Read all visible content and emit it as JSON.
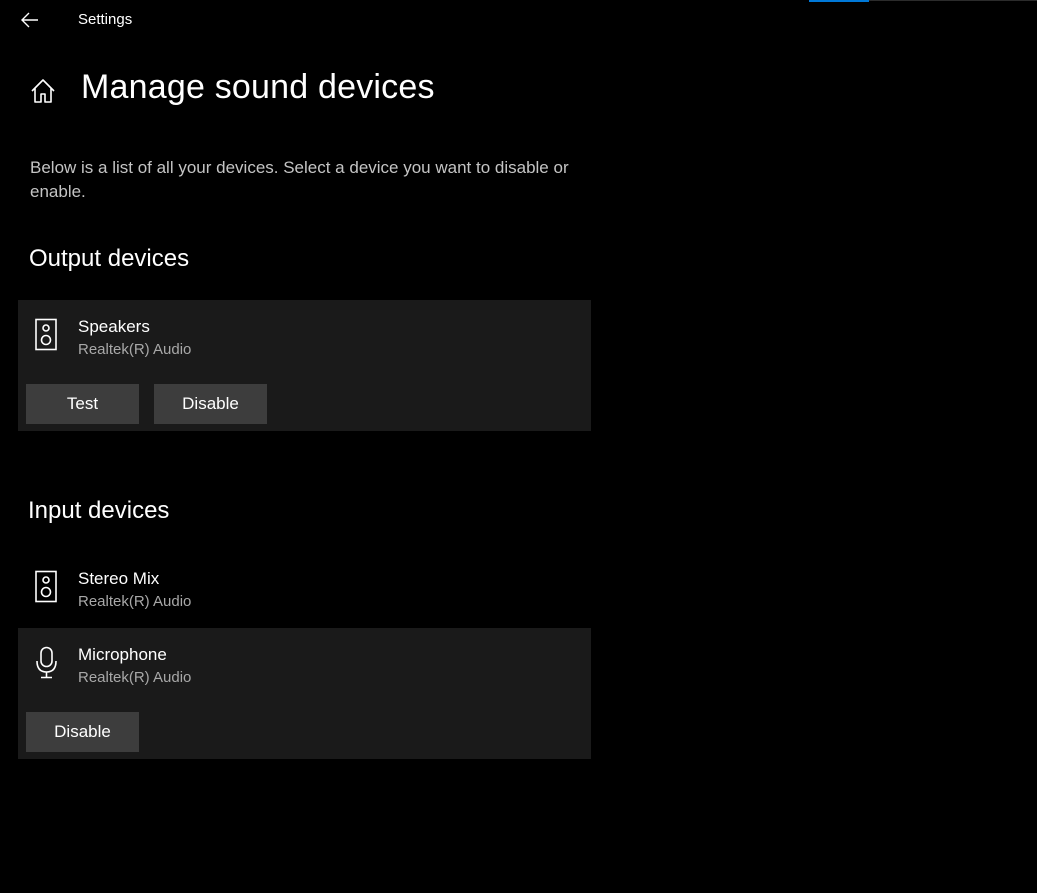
{
  "window": {
    "app_title": "Settings",
    "accent_color": "#0078d7"
  },
  "header": {
    "back_icon": "back-arrow-icon",
    "home_icon": "home-icon",
    "page_title": "Manage sound devices"
  },
  "description": "Below is a list of all your devices. Select a device you want to disable or enable.",
  "output_section": {
    "heading": "Output devices",
    "devices": [
      {
        "name": "Speakers",
        "driver": "Realtek(R) Audio",
        "icon": "speaker-icon",
        "selected": true,
        "buttons": [
          "Test",
          "Disable"
        ]
      }
    ]
  },
  "input_section": {
    "heading": "Input devices",
    "devices": [
      {
        "name": "Stereo Mix",
        "driver": "Realtek(R) Audio",
        "icon": "speaker-icon",
        "selected": false,
        "buttons": []
      },
      {
        "name": "Microphone",
        "driver": "Realtek(R) Audio",
        "icon": "microphone-icon",
        "selected": true,
        "buttons": [
          "Disable"
        ]
      }
    ]
  }
}
